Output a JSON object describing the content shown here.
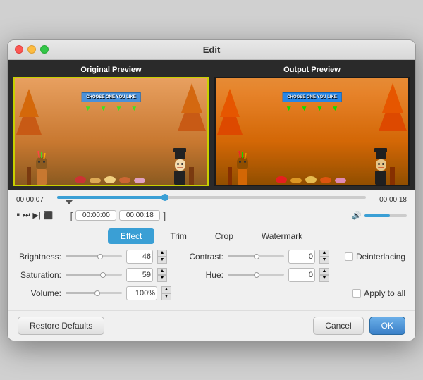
{
  "window": {
    "title": "Edit"
  },
  "previews": {
    "original_label": "Original Preview",
    "output_label": "Output Preview",
    "banner_text": "CHOOSE ONE YOU LIKE"
  },
  "timeline": {
    "start_time": "00:00:07",
    "end_time": "00:00:18",
    "fill_percent": 35
  },
  "transport": {
    "range_start": "00:00:00",
    "range_end": "00:00:18"
  },
  "tabs": [
    {
      "id": "effect",
      "label": "Effect",
      "active": true
    },
    {
      "id": "trim",
      "label": "Trim",
      "active": false
    },
    {
      "id": "crop",
      "label": "Crop",
      "active": false
    },
    {
      "id": "watermark",
      "label": "Watermark",
      "active": false
    }
  ],
  "settings": {
    "brightness": {
      "label": "Brightness:",
      "value": "46",
      "fill_percent": 60
    },
    "contrast": {
      "label": "Contrast:",
      "value": "0",
      "fill_percent": 50
    },
    "saturation": {
      "label": "Saturation:",
      "value": "59",
      "fill_percent": 65
    },
    "hue": {
      "label": "Hue:",
      "value": "0",
      "fill_percent": 50
    },
    "volume": {
      "label": "Volume:",
      "value": "100%",
      "fill_percent": 55
    },
    "deinterlacing_label": "Deinterlacing",
    "apply_all_label": "Apply to all"
  },
  "buttons": {
    "restore_defaults": "Restore Defaults",
    "cancel": "Cancel",
    "ok": "OK"
  }
}
